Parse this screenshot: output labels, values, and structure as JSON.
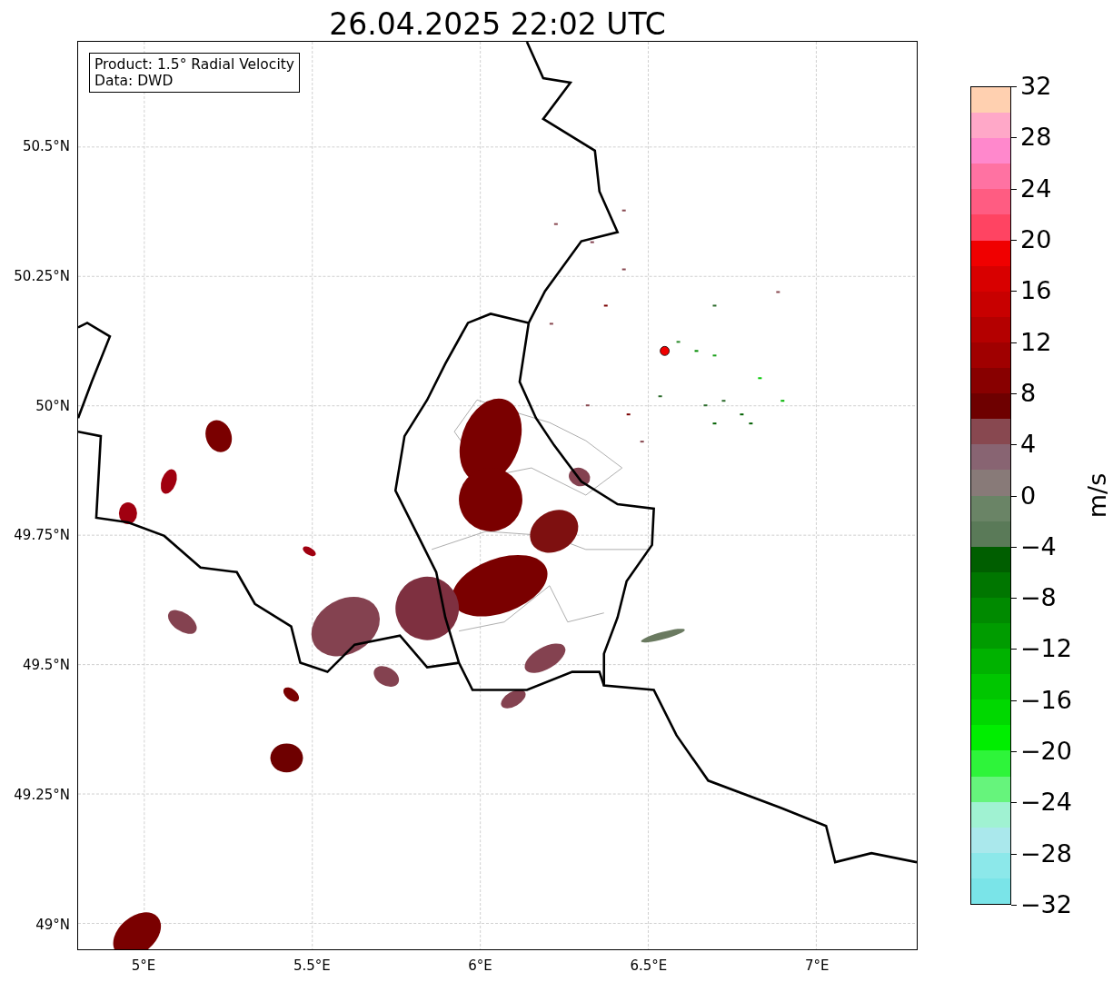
{
  "title": "26.04.2025 22:02 UTC",
  "info_box": {
    "lines": [
      "Product: 1.5° Radial Velocity",
      "Data: DWD"
    ]
  },
  "y_ticks": [
    "50.5°N",
    "50.25°N",
    "50°N",
    "49.75°N",
    "49.5°N",
    "49.25°N",
    "49°N"
  ],
  "x_ticks": [
    "5°E",
    "5.5°E",
    "6°E",
    "6.5°E",
    "7°E"
  ],
  "colorbar": {
    "label": "m/s",
    "ticks": [
      "32",
      "28",
      "24",
      "20",
      "16",
      "12",
      "8",
      "4",
      "0",
      "−4",
      "−8",
      "−12",
      "−16",
      "−20",
      "−24",
      "−28",
      "−32"
    ]
  }
}
